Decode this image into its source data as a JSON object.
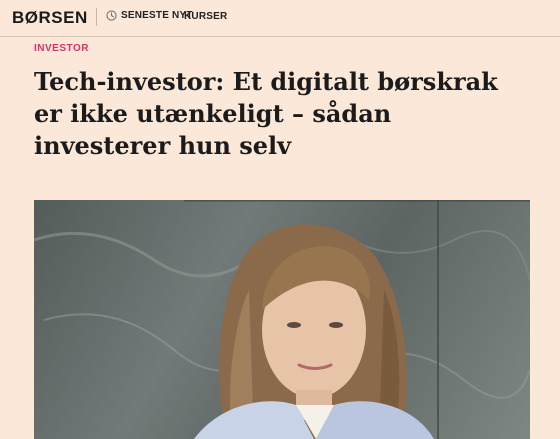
{
  "header": {
    "logo": "BØRSEN",
    "nav": {
      "latest_label": "SENESTE NYT",
      "latest_icon": "clock-icon",
      "courses_label": "KURSER"
    }
  },
  "article": {
    "category": "INVESTOR",
    "headline": "Tech-investor: Et digitalt børskrak er ikke utænkeligt – sådan investerer hun selv",
    "accent_color": "#d6336a"
  }
}
